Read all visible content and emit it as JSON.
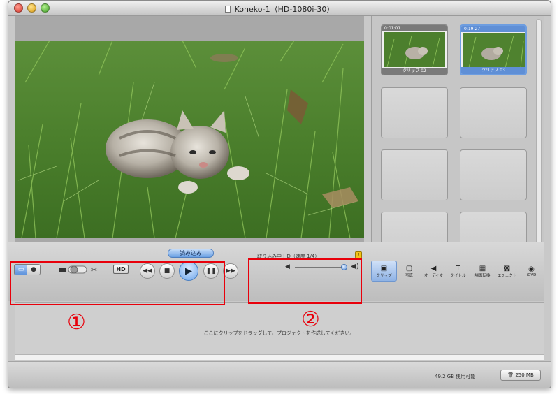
{
  "window": {
    "title": "Koneko-1（HD-1080i-30）"
  },
  "clips": [
    {
      "timecode": "0:01:01",
      "name": "クリップ 02",
      "selected": false
    },
    {
      "timecode": "0:19:27",
      "name": "クリップ 03",
      "selected": true
    }
  ],
  "controls": {
    "import_label": "読み込み",
    "hd_label": "HD",
    "mode_icons": [
      "camera-mode-icon",
      "edit-mode-icon"
    ],
    "transport_icons": [
      "rewind-icon",
      "stop-icon",
      "play-icon",
      "pause-icon",
      "fast-forward-icon"
    ]
  },
  "capture": {
    "status": "取り込み中 HD（速度 1/4）",
    "warning": "!"
  },
  "pane_tabs": [
    {
      "label": "クリップ",
      "icon": "clip-icon",
      "active": true
    },
    {
      "label": "写真",
      "icon": "photo-icon",
      "active": false
    },
    {
      "label": "オーディオ",
      "icon": "audio-icon",
      "active": false
    },
    {
      "label": "タイトル",
      "icon": "title-icon",
      "active": false
    },
    {
      "label": "場面転換",
      "icon": "transition-icon",
      "active": false
    },
    {
      "label": "エフェクト",
      "icon": "effect-icon",
      "active": false
    },
    {
      "label": "iDVD",
      "icon": "idvd-icon",
      "active": false
    }
  ],
  "timeline": {
    "hint": "ここにクリップをドラッグして、プロジェクトを作成してください。"
  },
  "status": {
    "free_space": "49.2 GB 使用可能",
    "trash_label": "250 MB"
  },
  "annotations": {
    "marker_1": "①",
    "marker_2": "②",
    "color": "#e8000b"
  }
}
